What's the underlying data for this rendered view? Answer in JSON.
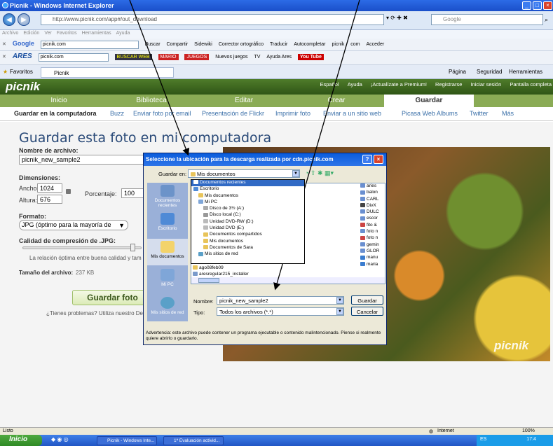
{
  "window": {
    "title": "Picnik - Windows Internet Explorer"
  },
  "address": {
    "url": "http://www.picnik.com/app#/out_download",
    "search_placeholder": "Google"
  },
  "menu": [
    "Archivo",
    "Edición",
    "Ver",
    "Favoritos",
    "Herramientas",
    "Ayuda"
  ],
  "google_toolbar": {
    "search": "picnik.com",
    "items": [
      "Buscar",
      "Compartir",
      "Sidewiki",
      "Corrector ortográfico",
      "Traducir",
      "Autocompletar",
      "picnik",
      "com",
      "Acceder"
    ]
  },
  "ares_toolbar": {
    "search": "picnik.com",
    "items": [
      "BUSCAR WEB",
      "MARIO",
      "JUEGOS",
      "Nuevos juegos",
      "TV",
      "Ayuda Ares",
      "You Tube"
    ]
  },
  "favorites_bar": {
    "favorites": "Favoritos",
    "tab": "Picnik",
    "tools": [
      "Página",
      "Seguridad",
      "Herramientas"
    ]
  },
  "picnik": {
    "logo": "picnik",
    "top_links": [
      "Español",
      "Ayuda",
      "¡Actualízate a Premium!",
      "Registrarse",
      "Iniciar sesión",
      "Pantalla completa"
    ],
    "tabs": [
      "Inicio",
      "Biblioteca",
      "Editar",
      "Crear",
      "Guardar"
    ],
    "active_tab": "Guardar",
    "sub_tabs": [
      "Guardar en la computadora",
      "Buzz",
      "Enviar foto por email",
      "Presentación de Flickr",
      "Imprimir foto",
      "Enviar a un sitio web",
      "Picasa Web Albums",
      "Twitter",
      "Más"
    ],
    "heading": "Guardar esta foto en mi computadora",
    "filename_label": "Nombre de archivo:",
    "filename_value": "picnik_new_sample2",
    "dimensions_label": "Dimensiones:",
    "width_label": "Ancho:",
    "width_value": "1024",
    "height_label": "Altura:",
    "height_value": "676",
    "percentage_label": "Porcentaje:",
    "percentage_value": "100",
    "format_label": "Formato:",
    "format_value": "JPG (óptimo para la mayoría de",
    "quality_label": "Calidad de compresión de .JPG:",
    "quality_text": "La relación óptima entre buena calidad y tam",
    "filesize_label": "Tamaño del archivo:",
    "filesize_value": "237 KB",
    "save_button": "Guardar foto",
    "problems_text": "¿Tienes problemas? Utiliza nuestro De",
    "watermark": "picnik"
  },
  "dialog": {
    "title": "Seleccione la ubicación para la descarga realizada por cdn.picnik.com",
    "save_in_label": "Guardar en:",
    "save_in_value": "Mis documentos",
    "places": [
      "Documentos recientes",
      "Escritorio",
      "Mis documentos",
      "Mi PC",
      "Mis sitios de red"
    ],
    "dropdown_items": [
      "Documentos recientes",
      "Escritorio",
      "Mis documentos",
      "Mi PC",
      "Disco de 3½ (A:)",
      "Disco local (C:)",
      "Unidad DVD-RW (D:)",
      "Unidad DVD (E:)",
      "Documentos compartidos",
      "Mis documentos",
      "Documentos de Sara",
      "Mis sitios de red"
    ],
    "files_below": [
      "ago08feb09",
      "aresregular215_installer"
    ],
    "files_right": [
      "aries",
      "balon",
      "CARL",
      "DivX",
      "DULC",
      "escor",
      "fito &",
      "foto n",
      "foto n",
      "gemin",
      "GLOR",
      "manu",
      "maria"
    ],
    "name_label": "Nombre:",
    "name_value": "picnik_new_sample2",
    "type_label": "Tipo:",
    "type_value": "Todos los archivos (*.*)",
    "save_button": "Guardar",
    "cancel_button": "Cancelar",
    "warning": "Advertencia: este archivo puede contener un programa ejecutable o contenido malintencionado. Piense si realmente quiere abrirlo o guardarlo."
  },
  "status": {
    "left": "Listo",
    "zone": "Internet",
    "zoom": "100%"
  },
  "taskbar": {
    "start": "Inicio",
    "tasks": [
      "Picnik - Windows Inte...",
      "1ª Evaluación activid..."
    ],
    "tray": "ES",
    "clock": "17:4"
  }
}
